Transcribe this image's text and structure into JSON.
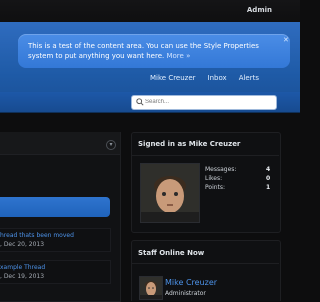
{
  "topbar": {
    "admin_label": "Admin"
  },
  "notice": {
    "text": "This is a test of the content area. You can use the Style Properties system to put anything you want here.",
    "more": "More »",
    "close_icon": "close-icon"
  },
  "nav": {
    "links": [
      "Mike Creuzer",
      "Inbox",
      "Alerts"
    ]
  },
  "search": {
    "placeholder": "Search..."
  },
  "left_panel": {
    "item1": {
      "title": "hread thats been moved",
      "date": ", Dec 20, 2013"
    },
    "item2": {
      "title": "xample Thread",
      "date": ", Dec 19, 2013"
    }
  },
  "signed_in": {
    "title": "Signed in as Mike Creuzer",
    "stats": [
      {
        "label": "Messages:",
        "value": "4"
      },
      {
        "label": "Likes:",
        "value": "0"
      },
      {
        "label": "Points:",
        "value": "1"
      }
    ]
  },
  "staff_online": {
    "title": "Staff Online Now",
    "member": {
      "name": "Mike Creuzer",
      "role": "Administrator"
    }
  },
  "colors": {
    "accent": "#2f6cbf",
    "link": "#4d93ea"
  }
}
